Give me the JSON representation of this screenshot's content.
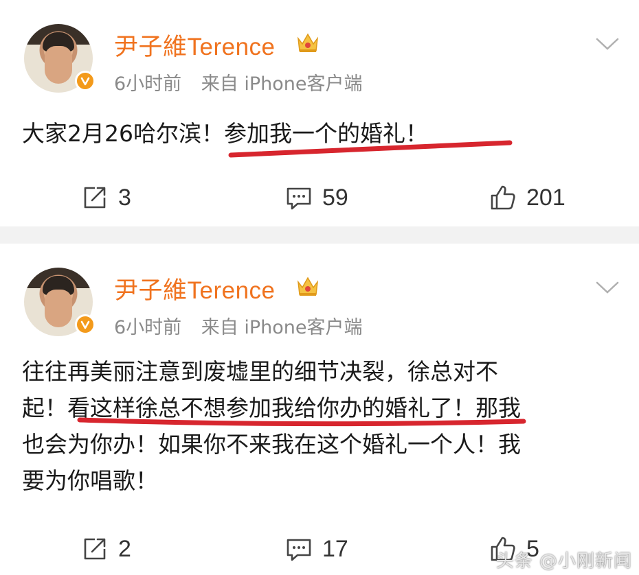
{
  "posts": [
    {
      "username": "尹子維Terence",
      "time": "6小时前",
      "source": "来自 iPhone客户端",
      "content_plain": "大家2月26哈尔滨！",
      "content_highlight": "参加我一个的婚礼！",
      "reposts": "3",
      "comments": "59",
      "likes": "201"
    },
    {
      "username": "尹子維Terence",
      "time": "6小时前",
      "source": "来自 iPhone客户端",
      "content_line1": "往往再美丽注意到废墟里的细节决裂，徐总对不",
      "content_line2_pre": "起！",
      "content_line2_highlight": "看这样徐总不想参加我给你办的婚礼了",
      "content_line2_post": "！那我",
      "content_line3": "也会为你办！如果你不来我在这个婚礼一个人！我",
      "content_line4": "要为你唱歌！",
      "reposts": "2",
      "comments": "17",
      "likes": "5"
    }
  ],
  "icons": {
    "avatar": "avatar-photo",
    "verified": "verified-v-icon",
    "crown": "crown-icon",
    "chevron": "chevron-down-icon",
    "repost": "repost-icon",
    "comment": "comment-icon",
    "like": "thumbs-up-icon"
  },
  "colors": {
    "username": "#f0731f",
    "verified": "#f39a1b",
    "underline": "#d7262e",
    "meta": "#8a8a8a",
    "separator": "#f2f2f2"
  },
  "watermark": "头条 @小刚新闻"
}
